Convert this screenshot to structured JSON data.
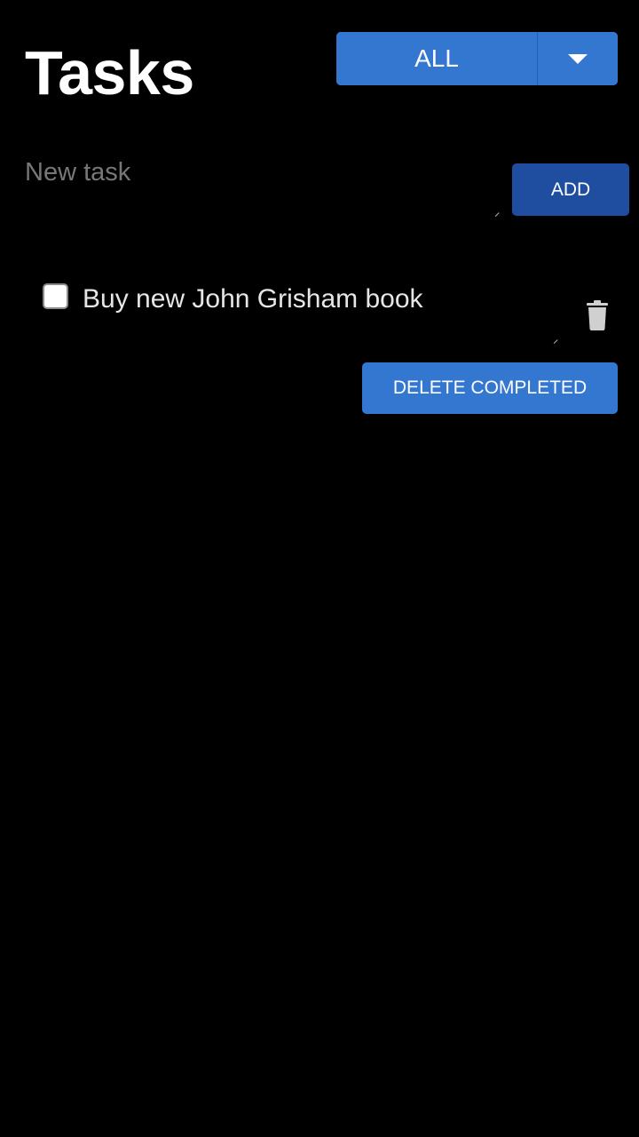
{
  "header": {
    "title": "Tasks"
  },
  "filter": {
    "selected": "ALL",
    "toggle_icon": "chevron-down-icon"
  },
  "new_task": {
    "placeholder": "New task",
    "value": "",
    "add_label": "ADD"
  },
  "tasks": [
    {
      "label": "Buy new John Grisham book",
      "completed": false,
      "delete_icon": "trash-icon"
    }
  ],
  "actions": {
    "delete_completed_label": "DELETE COMPLETED"
  },
  "colors": {
    "background": "#000000",
    "primary_button": "#3477d1",
    "add_button": "#1f4ea0",
    "text": "#ffffff",
    "placeholder": "#777777"
  }
}
